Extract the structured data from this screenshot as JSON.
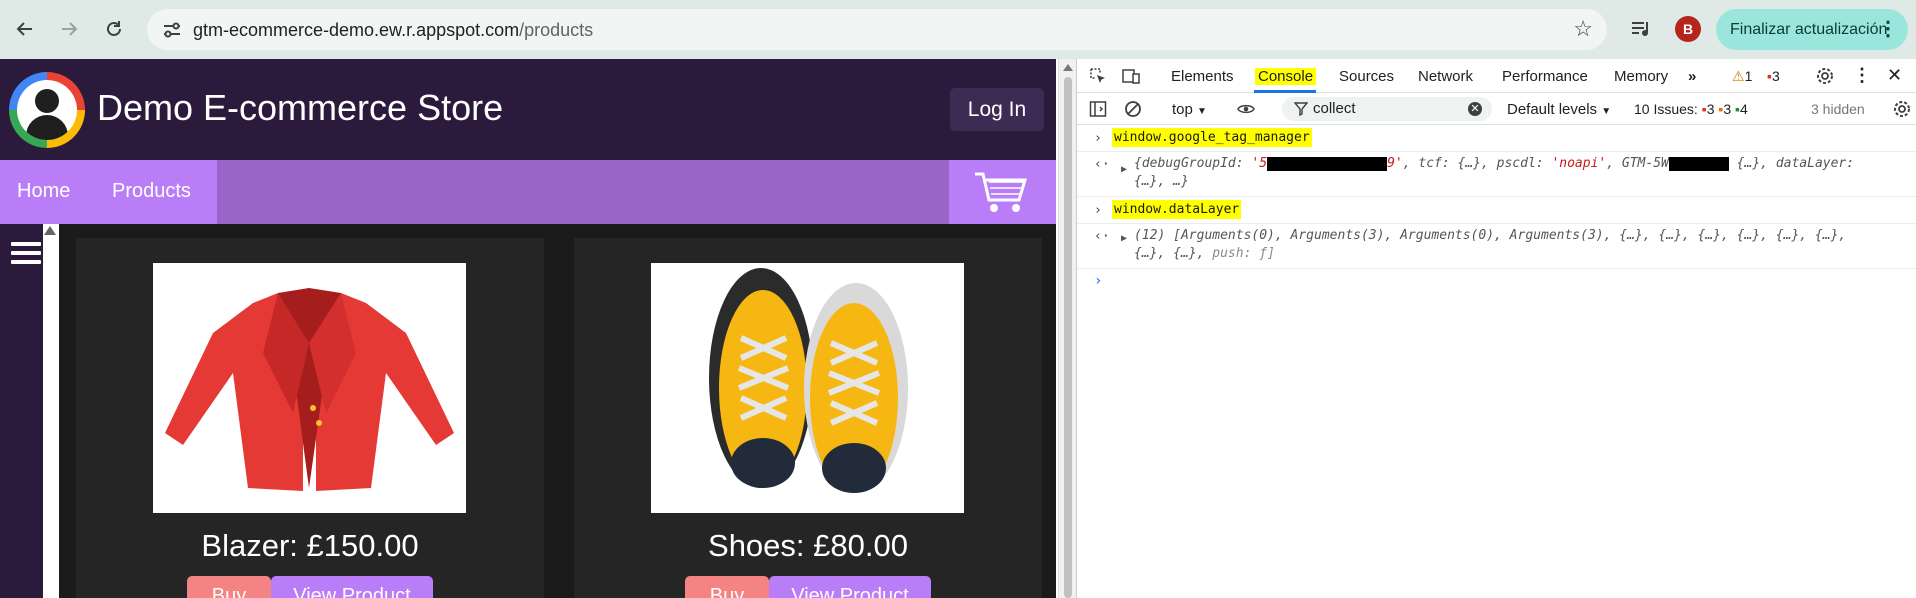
{
  "browser": {
    "url_host": "gtm-ecommerce-demo.ew.r.appspot.com",
    "url_path": "/products",
    "profile_initial": "B",
    "update_label": "Finalizar actualización"
  },
  "site": {
    "title": "Demo E-commerce Store",
    "login_label": "Log In",
    "nav": [
      "Home",
      "Products"
    ],
    "products": [
      {
        "title": "Blazer: £150.00",
        "buy_label": "Buy",
        "view_label": "View Product"
      },
      {
        "title": "Shoes: £80.00",
        "buy_label": "Buy",
        "view_label": "View Product"
      }
    ]
  },
  "devtools": {
    "tabs": [
      "Elements",
      "Console",
      "Sources",
      "Network",
      "Performance",
      "Memory"
    ],
    "active_tab": "Console",
    "warnings_count": "1",
    "errors_count": "3",
    "context": "top",
    "filter_value": "collect",
    "levels_label": "Default levels",
    "issues_label": "10 Issues:",
    "issues_red": "3",
    "issues_orange": "3",
    "issues_blue": "4",
    "hidden_label": "3 hidden",
    "console": {
      "cmd1": "window.google_tag_manager",
      "out1_a": "{debugGroupId: ",
      "out1_str1a": "'5",
      "out1_str1b": "9'",
      "out1_b": ", tcf: {…}, pscdl: ",
      "out1_str2": "'noapi'",
      "out1_c": ", GTM-5W",
      "out1_d": " {…}, dataLayer:",
      "out1_line2": "{…}, …}",
      "cmd2": "window.dataLayer",
      "out2_line1": "(12) [Arguments(0), Arguments(3), Arguments(0), Arguments(3), {…}, {…}, {…}, {…}, {…}, {…},",
      "out2_line2a": "{…}, {…}, ",
      "out2_line2b": "push: ƒ]"
    }
  },
  "colors": {
    "site_header": "#2b1a3b",
    "nav_bar": "#9965c9",
    "accent_purple": "#b97ef7",
    "buy_pink": "#f48484",
    "highlight": "#ffff00"
  }
}
